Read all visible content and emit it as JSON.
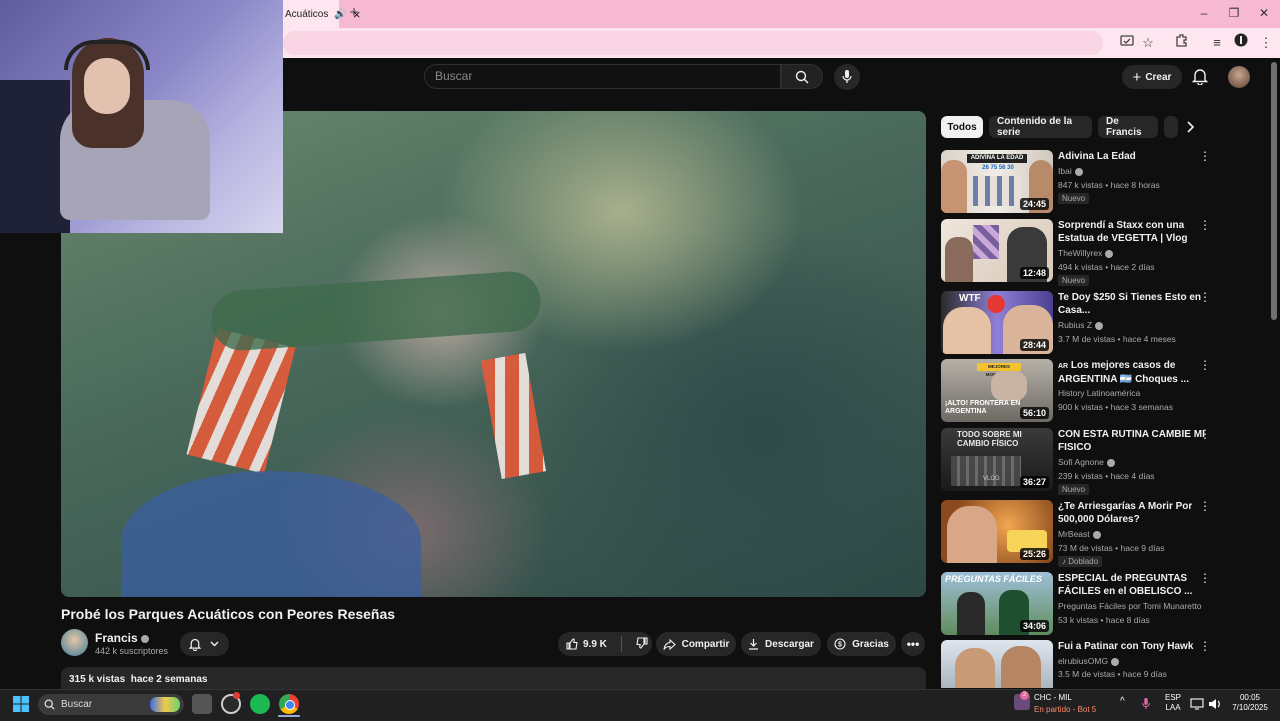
{
  "browser": {
    "tab_title": "Acuáticos",
    "new_tab": "+",
    "close_tab": "×",
    "window_controls": [
      "–",
      "❐",
      "✕"
    ]
  },
  "header": {
    "search_placeholder": "Buscar",
    "create_label": "Crear"
  },
  "video": {
    "title": "Probé los Parques Acuáticos con Peores Reseñas",
    "channel": "Francis",
    "subscribers": "442 k suscriptores",
    "likes": "9.9 K",
    "share": "Compartir",
    "download": "Descargar",
    "thanks": "Gracias",
    "views": "315 k vistas",
    "age": "hace 2 semanas"
  },
  "chips": [
    "Todos",
    "Contenido de la serie",
    "De Francis"
  ],
  "recommendations": [
    {
      "title": "Adivina La Edad",
      "channel": "Ibai",
      "views": "847 k vistas",
      "age": "hace 8 horas",
      "duration": "24:45",
      "badge": "Nuevo",
      "thumb_text": "ADIVINA LA EDAD",
      "thumb_nums": "26 75 56 30"
    },
    {
      "title": "Sorprendí a Staxx con una Estatua de VEGETTA | Vlog",
      "channel": "TheWillyrex",
      "views": "494 k vistas",
      "age": "hace 2 días",
      "duration": "12:48",
      "badge": "Nuevo"
    },
    {
      "title": "Te Doy $250 Si Tienes Esto en Casa...",
      "channel": "Rubius Z",
      "views": "3.7 M de vistas",
      "age": "hace 4 meses",
      "duration": "28:44",
      "thumb_text": "WTF"
    },
    {
      "title": "Los mejores casos de ARGENTINA 🇦🇷 Choques ...",
      "channel": "History Latinoamérica",
      "views": "900 k vistas",
      "age": "hace 3 semanas",
      "duration": "56:10",
      "title_prefix": "AR",
      "thumb_text": "¡ALTO! FRONTERA EN ARGENTINA",
      "thumb_small": "MEJORES MOMENTOS"
    },
    {
      "title": "CON ESTA RUTINA CAMBIE MI FISICO",
      "channel": "Sofi Agnone",
      "views": "239 k vistas",
      "age": "hace 4 días",
      "duration": "36:27",
      "badge": "Nuevo",
      "thumb_text": "TODO SOBRE MI CAMBIO FÍSICO",
      "thumb_small": "VLOG"
    },
    {
      "title": "¿Te Arriesgarías A Morir Por 500,000 Dólares?",
      "channel": "MrBeast",
      "views": "73 M de vistas",
      "age": "hace 9 días",
      "duration": "25:26",
      "badge": "Doblado"
    },
    {
      "title": "ESPECIAL de PREGUNTAS FÁCILES en el OBELISCO ...",
      "channel": "Preguntas Fáciles por Tomi Munaretto",
      "views": "53 k vistas",
      "age": "hace 8 días",
      "duration": "34:06",
      "thumb_text": "PREGUNTAS FÁCILES"
    },
    {
      "title": "Fui a Patinar con Tony Hawk",
      "channel": "elrubiusOMG",
      "views": "3.5 M de vistas",
      "age": "hace 9 días"
    }
  ],
  "taskbar": {
    "search": "Buscar",
    "match": "CHC - MIL",
    "match_status": "En partido - Bot 5",
    "lang1": "ESP",
    "lang2": "LAA",
    "time": "00:05",
    "date": "7/10/2025",
    "notif_count": "2"
  },
  "colors": {
    "tab_bar": "#f7b8d2",
    "youtube_bg": "#0f0f0f",
    "pill_bg": "#272727",
    "match_status": "#ff8a6a"
  }
}
